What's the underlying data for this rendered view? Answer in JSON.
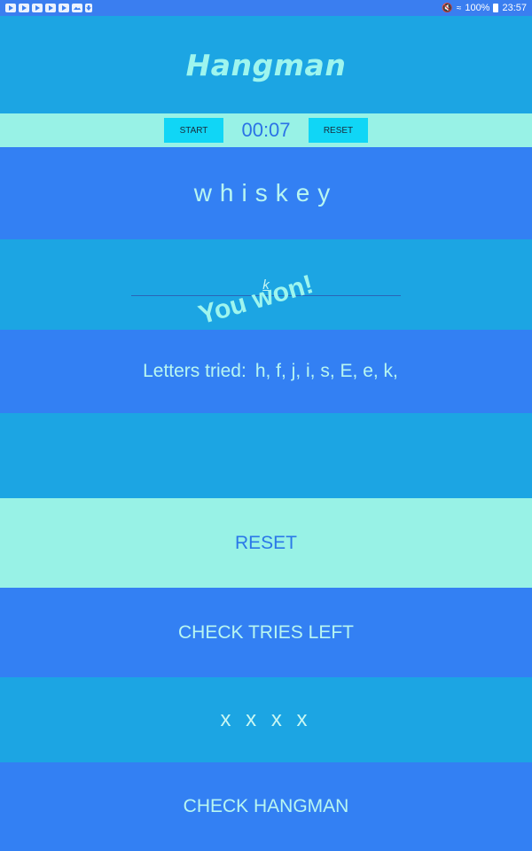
{
  "status_bar": {
    "notification_icons": [
      "video-play-icon",
      "video-play-icon",
      "video-play-icon",
      "video-play-icon",
      "video-play-icon",
      "gallery-icon",
      "download-icon"
    ],
    "battery": "100%",
    "time": "23:57"
  },
  "header": {
    "title": "Hangman"
  },
  "timer_bar": {
    "start_label": "START",
    "timer": "00:07",
    "reset_label": "RESET"
  },
  "game": {
    "secret_word": "whiskey",
    "input_value": "k",
    "letters_tried_label": "Letters tried:",
    "letters_tried": "h, f, j, i, s, E, e, k,",
    "toast": "You won!",
    "tries_left": "x x x x"
  },
  "actions": {
    "reset_label": "RESET",
    "check_tries_label": "CHECK TRIES LEFT",
    "check_hangman_label": "CHECK HANGMAN"
  },
  "colors": {
    "primary_blue": "#3380f3",
    "sky_blue": "#1ca5e3",
    "mint": "#98f2e6",
    "cyan_button": "#10d6f6",
    "text_light": "#b8f6f1"
  }
}
